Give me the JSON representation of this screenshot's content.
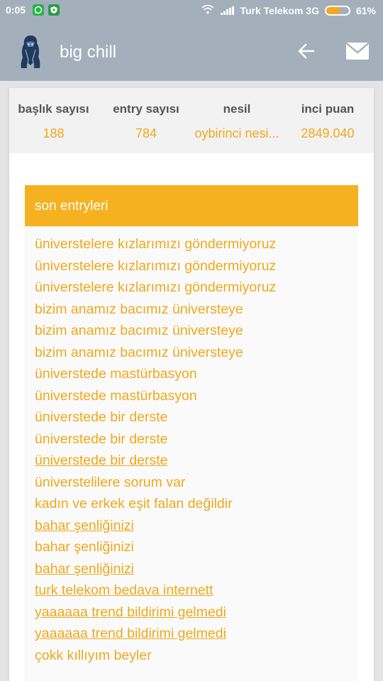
{
  "status_bar": {
    "time": "0:05",
    "carrier": "Turk Telekom 3G",
    "battery": "61%",
    "battery_level": 0.61,
    "app_icons": [
      "whatsapp-icon",
      "security-app-icon"
    ]
  },
  "header": {
    "title": "big chill",
    "background_color": "#a3b0bb",
    "icons": [
      "back-arrow-icon",
      "mail-icon"
    ]
  },
  "stats": [
    {
      "label": "başlık sayısı",
      "value": "188"
    },
    {
      "label": "entry sayısı",
      "value": "784"
    },
    {
      "label": "nesil",
      "value": "oybirinci nesi..."
    },
    {
      "label": "inci puan",
      "value": "2849.040"
    }
  ],
  "recent": {
    "title": "son entryleri",
    "accent_color": "#f5b120",
    "entries": [
      {
        "text": "üniverstelere kızlarımızı göndermiyoruz",
        "underlined": false
      },
      {
        "text": "üniverstelere kızlarımızı göndermiyoruz",
        "underlined": false
      },
      {
        "text": "üniverstelere kızlarımızı göndermiyoruz",
        "underlined": false
      },
      {
        "text": "bizim anamız bacımız üniversteye",
        "underlined": false
      },
      {
        "text": "bizim anamız bacımız üniversteye",
        "underlined": false
      },
      {
        "text": "bizim anamız bacımız üniversteye",
        "underlined": false
      },
      {
        "text": "üniverstede mastürbasyon",
        "underlined": false
      },
      {
        "text": "üniverstede mastürbasyon",
        "underlined": false
      },
      {
        "text": "üniverstede bir derste",
        "underlined": false
      },
      {
        "text": "üniverstede bir derste",
        "underlined": false
      },
      {
        "text": "üniverstede bir derste",
        "underlined": true
      },
      {
        "text": "üniverstelilere sorum var",
        "underlined": false
      },
      {
        "text": "kadın ve erkek eşit falan değildir",
        "underlined": false
      },
      {
        "text": "bahar şenliğinizi",
        "underlined": true
      },
      {
        "text": "bahar şenliğinizi",
        "underlined": false
      },
      {
        "text": "bahar şenliğinizi",
        "underlined": true
      },
      {
        "text": "turk telekom bedava internett",
        "underlined": true
      },
      {
        "text": "yaaaaaa trend bildirimi gelmedi",
        "underlined": true
      },
      {
        "text": "yaaaaaa trend bildirimi gelmedi",
        "underlined": true
      },
      {
        "text": "çokk kıllıyım beyler",
        "underlined": false
      }
    ]
  }
}
